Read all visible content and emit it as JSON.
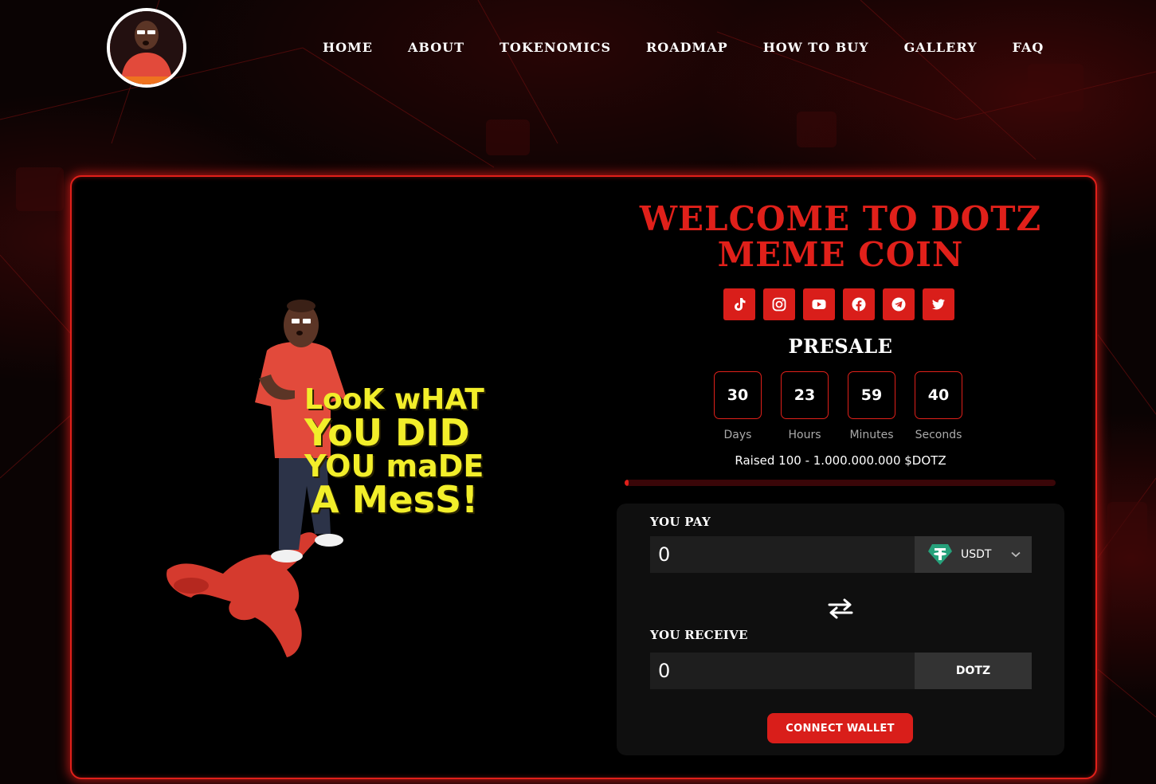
{
  "nav": {
    "items": [
      "HOME",
      "ABOUT",
      "TOKENOMICS",
      "ROADMAP",
      "HOW TO BUY",
      "GALLERY",
      "FAQ"
    ]
  },
  "hero": {
    "meme_lines": [
      "LooK wHAT",
      "YoU DID",
      "YOU maDE",
      "A MesS!"
    ]
  },
  "presale_panel": {
    "title": "WELCOME TO DOTZ MEME COIN",
    "socials": [
      "tiktok-icon",
      "instagram-icon",
      "youtube-icon",
      "facebook-icon",
      "telegram-icon",
      "twitter-icon"
    ],
    "presale_heading": "PRESALE",
    "countdown": [
      {
        "value": "30",
        "label": "Days"
      },
      {
        "value": "23",
        "label": "Hours"
      },
      {
        "value": "59",
        "label": "Minutes"
      },
      {
        "value": "40",
        "label": "Seconds"
      }
    ],
    "raised_text": "Raised 100 - 1.000.000.000 $DOTZ",
    "progress_fraction": 1e-07
  },
  "swap": {
    "pay_label": "YOU PAY",
    "pay_value": "0",
    "pay_token": "USDT",
    "receive_label": "YOU RECEIVE",
    "receive_value": "0",
    "receive_token": "DOTZ",
    "connect_label": "CONNECT WALLET"
  },
  "colors": {
    "accent": "#e0201a",
    "meme_text": "#f2ee2a",
    "usdt": "#26a17b"
  }
}
